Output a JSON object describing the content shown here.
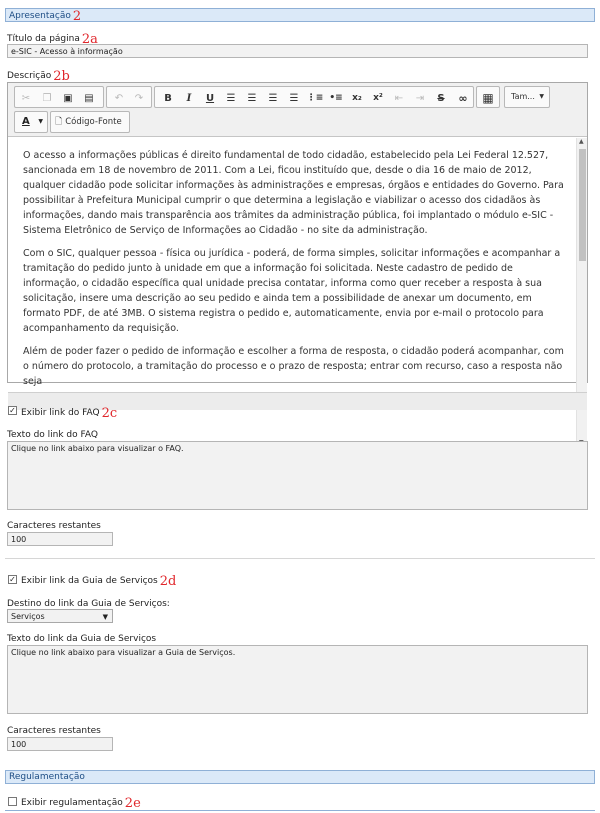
{
  "apresentacao": {
    "header": "Apresentação",
    "header_ann": "2",
    "titulo_label": "Título da página",
    "titulo_ann": "2a",
    "titulo_value": "e-SIC - Acesso à informação",
    "descricao_label": "Descrição",
    "descricao_ann": "2b"
  },
  "editor": {
    "toolbar": {
      "cut_icon": "cut-icon",
      "copy_icon": "copy-icon",
      "paste_icon": "paste-icon",
      "paste_text_icon": "paste-text-icon",
      "undo_icon": "undo-icon",
      "redo_icon": "redo-icon",
      "bold": "B",
      "italic": "I",
      "underline": "U",
      "sub": "x₂",
      "sup": "x²",
      "strike": "S",
      "size_label": "Tam...",
      "font_color": "A",
      "source_label": "Código-Fonte"
    },
    "paragraphs": [
      "O acesso a informações públicas é direito fundamental de todo cidadão, estabelecido pela Lei Federal 12.527, sancionada em 18 de novembro de 2011. Com a Lei, ficou instituído que, desde o dia 16 de maio de 2012, qualquer cidadão pode solicitar informações às administrações e empresas, órgãos e entidades do Governo. Para possibilitar à Prefeitura Municipal cumprir o que determina a legislação e viabilizar o acesso dos cidadãos às informações, dando mais transparência aos trâmites da administração pública, foi implantado o módulo e-SIC - Sistema Eletrônico de Serviço de Informações ao Cidadão - no site da administração.",
      "Com o SIC, qualquer pessoa - física ou jurídica - poderá, de forma simples, solicitar informações e acompanhar a tramitação do pedido junto à unidade em que a informação foi solicitada. Neste cadastro de pedido de informação, o cidadão específica qual unidade precisa contatar, informa como quer receber a resposta à sua solicitação, insere uma descrição ao seu pedido e ainda tem a possibilidade de anexar um documento, em formato PDF, de até 3MB. O sistema registra o pedido e, automaticamente, envia por e-mail o protocolo para acompanhamento da requisição.",
      "Além de poder fazer o pedido de informação e escolher a forma de resposta, o cidadão poderá acompanhar, com o número do protocolo, a tramitação do processo e o prazo de resposta; entrar com recurso, caso a resposta não seja"
    ]
  },
  "faq": {
    "checkbox_label": "Exibir link do FAQ",
    "ann": "2c",
    "checked": true,
    "texto_label": "Texto do link do FAQ",
    "texto_value": "Clique no link abaixo para visualizar o FAQ.",
    "restantes_label": "Caracteres restantes",
    "restantes_value": "100"
  },
  "guia": {
    "checkbox_label": "Exibir link da Guia de Serviços",
    "ann": "2d",
    "checked": true,
    "destino_label": "Destino do link da Guia de Serviços:",
    "destino_value": "Serviços",
    "texto_label": "Texto do link da Guia de Serviços",
    "texto_value": "Clique no link abaixo para visualizar a Guia de Serviços.",
    "restantes_label": "Caracteres restantes",
    "restantes_value": "100"
  },
  "regulamentacao": {
    "header": "Regulamentação",
    "checkbox_label": "Exibir regulamentação",
    "ann": "2e",
    "checked": false
  },
  "colors": {
    "header_bg": "#dbe9f8",
    "header_border": "#8fb0d6",
    "annotation": "#e0262b"
  }
}
